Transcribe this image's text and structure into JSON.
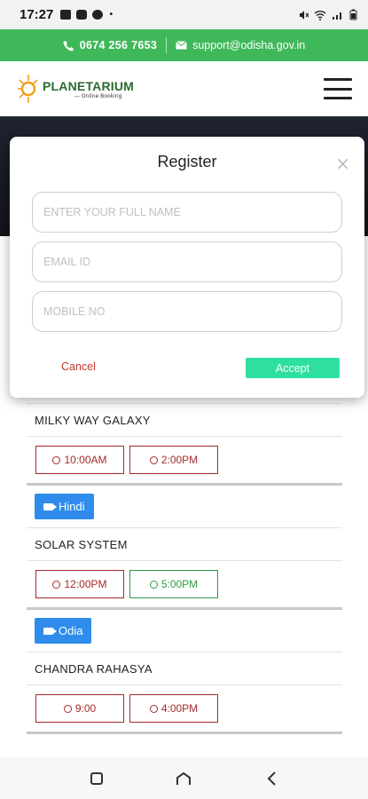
{
  "status_bar": {
    "time": "17:27",
    "bullet": "•"
  },
  "contact": {
    "phone": "0674 256 7653",
    "email": "support@odisha.gov.in"
  },
  "header": {
    "logo_title": "PLANETARIUM",
    "logo_subtitle": "— Online Booking"
  },
  "shows": [
    {
      "language": "",
      "title": "MILKY WAY GALAXY",
      "times": [
        {
          "label": "10:00AM",
          "status": "red"
        },
        {
          "label": "2:00PM",
          "status": "red"
        }
      ]
    },
    {
      "language": "Hindi",
      "title": "SOLAR SYSTEM",
      "times": [
        {
          "label": "12:00PM",
          "status": "red"
        },
        {
          "label": "5:00PM",
          "status": "green"
        }
      ]
    },
    {
      "language": "Odia",
      "title": "CHANDRA RAHASYA",
      "times": [
        {
          "label": "9:00",
          "status": "red"
        },
        {
          "label": "4:00PM",
          "status": "red"
        }
      ]
    }
  ],
  "modal": {
    "title": "Register",
    "close_icon": "×",
    "name_placeholder": "ENTER YOUR FULL NAME",
    "email_placeholder": "EMAIL ID",
    "mobile_placeholder": "MOBILE NO",
    "cancel_label": "Cancel",
    "accept_label": "Accept"
  },
  "colors": {
    "green_bar": "#3fb85a",
    "badge_blue": "#2f8cec",
    "accept": "#2ee0a0",
    "red_time": "#a52a2a",
    "green_time": "#2e9b43"
  }
}
